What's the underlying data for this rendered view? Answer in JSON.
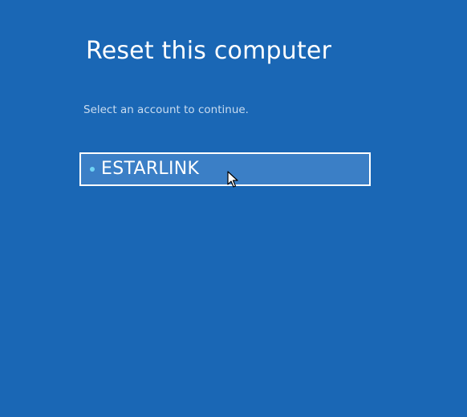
{
  "window": {
    "title": "Reset this computer",
    "background_color": "#1a67b5"
  },
  "prompt": {
    "text": "Select an account to continue."
  },
  "accounts": [
    {
      "name": "ESTARLINK",
      "selected": true,
      "bullet_color": "#6fd3f5"
    }
  ],
  "icons": {
    "cursor": "mouse-pointer-icon"
  }
}
